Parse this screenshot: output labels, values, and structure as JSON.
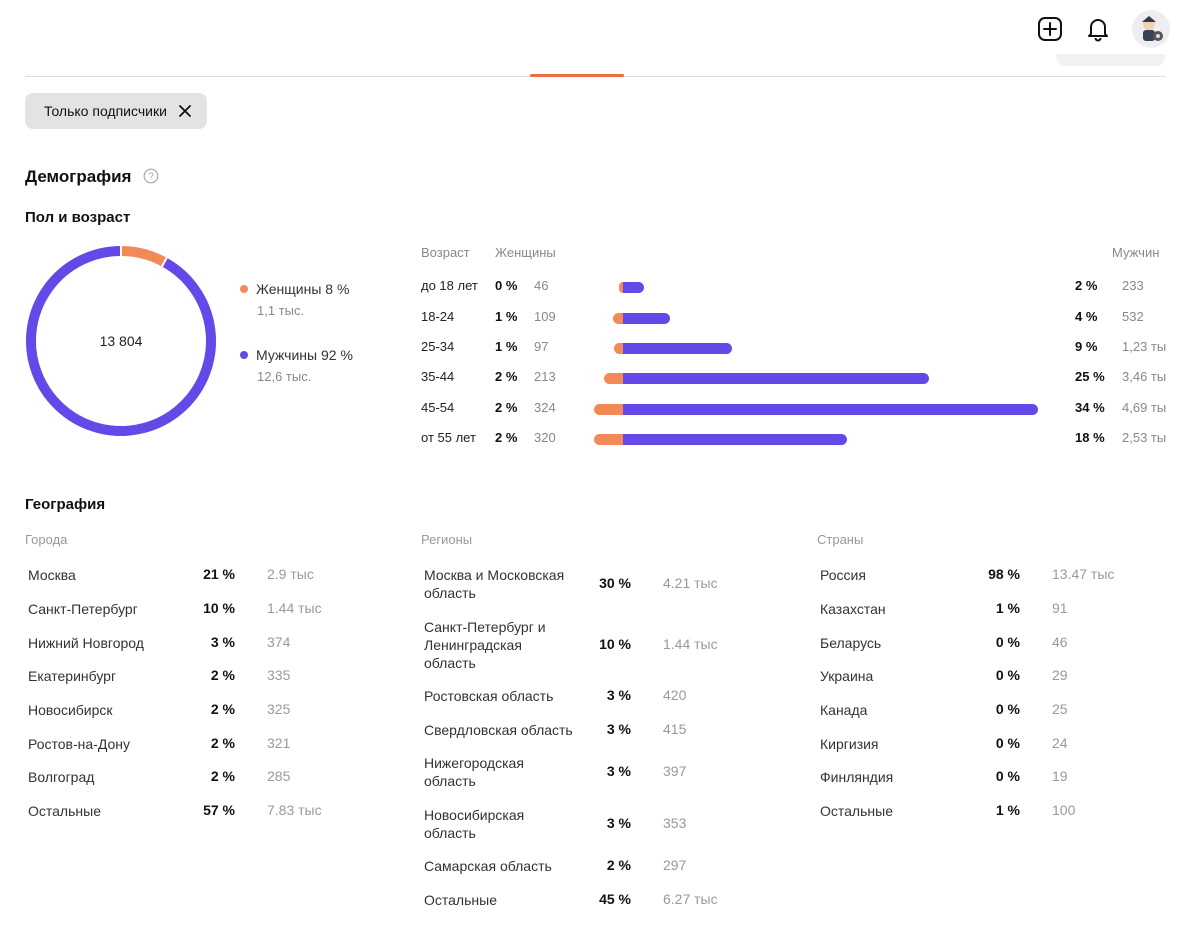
{
  "header": {
    "icons": [
      "add-post-icon",
      "bell-icon",
      "avatar"
    ]
  },
  "filter": {
    "chip_label": "Только подписчики"
  },
  "demography": {
    "title": "Демография",
    "gender_age_title": "Пол и возраст",
    "total": "13 804",
    "legend": [
      {
        "label": "Женщины 8 %",
        "sub": "1,1 тыс.",
        "color": "#f28a57"
      },
      {
        "label": "Мужчины 92 %",
        "sub": "12,6 тыс.",
        "color": "#6548e8"
      }
    ],
    "columns": {
      "age": "Возраст",
      "women": "Женщины",
      "men": "Мужчин"
    },
    "age_rows": [
      {
        "age": "до 18 лет",
        "w_pct": "0 %",
        "w_count": "46",
        "m_pct": "2 %",
        "m_count": "233"
      },
      {
        "age": "18-24",
        "w_pct": "1 %",
        "w_count": "109",
        "m_pct": "4 %",
        "m_count": "532"
      },
      {
        "age": "25-34",
        "w_pct": "1 %",
        "w_count": "97",
        "m_pct": "9 %",
        "m_count": "1,23 ты"
      },
      {
        "age": "35-44",
        "w_pct": "2 %",
        "w_count": "213",
        "m_pct": "25 %",
        "m_count": "3,46 ты"
      },
      {
        "age": "45-54",
        "w_pct": "2 %",
        "w_count": "324",
        "m_pct": "34 %",
        "m_count": "4,69 ты"
      },
      {
        "age": "от 55 лет",
        "w_pct": "2 %",
        "w_count": "320",
        "m_pct": "18 %",
        "m_count": "2,53 ты"
      }
    ]
  },
  "chart_data": [
    {
      "type": "pie",
      "categories": [
        "Женщины",
        "Мужчины"
      ],
      "values": [
        8,
        92
      ],
      "center_label": "13 804"
    },
    {
      "type": "bar",
      "categories": [
        "до 18 лет",
        "18-24",
        "25-34",
        "35-44",
        "45-54",
        "от 55 лет"
      ],
      "series": [
        {
          "name": "Женщины",
          "values": [
            46,
            109,
            97,
            213,
            324,
            320
          ]
        },
        {
          "name": "Мужчин",
          "values": [
            233,
            532,
            1230,
            3460,
            4690,
            2530
          ]
        }
      ]
    }
  ],
  "geography": {
    "title": "География",
    "cities": {
      "title": "Города",
      "rows": [
        {
          "name": "Москва",
          "pct": "21 %",
          "count": "2.9 тыс"
        },
        {
          "name": "Санкт-Петербург",
          "pct": "10 %",
          "count": "1.44 тыс"
        },
        {
          "name": "Нижний Новгород",
          "pct": "3 %",
          "count": "374"
        },
        {
          "name": "Екатеринбург",
          "pct": "2 %",
          "count": "335"
        },
        {
          "name": "Новосибирск",
          "pct": "2 %",
          "count": "325"
        },
        {
          "name": "Ростов-на-Дону",
          "pct": "2 %",
          "count": "321"
        },
        {
          "name": "Волгоград",
          "pct": "2 %",
          "count": "285"
        },
        {
          "name": "Остальные",
          "pct": "57 %",
          "count": "7.83 тыс"
        }
      ]
    },
    "regions": {
      "title": "Регионы",
      "rows": [
        {
          "name": "Москва и Московская область",
          "pct": "30 %",
          "count": "4.21 тыс"
        },
        {
          "name": "Санкт-Петербург и Ленинградская область",
          "pct": "10 %",
          "count": "1.44 тыс"
        },
        {
          "name": "Ростовская область",
          "pct": "3 %",
          "count": "420"
        },
        {
          "name": "Свердловская область",
          "pct": "3 %",
          "count": "415"
        },
        {
          "name": "Нижегородская область",
          "pct": "3 %",
          "count": "397"
        },
        {
          "name": "Новосибирская область",
          "pct": "3 %",
          "count": "353"
        },
        {
          "name": "Самарская область",
          "pct": "2 %",
          "count": "297"
        },
        {
          "name": "Остальные",
          "pct": "45 %",
          "count": "6.27 тыс"
        }
      ]
    },
    "countries": {
      "title": "Страны",
      "rows": [
        {
          "name": "Россия",
          "pct": "98 %",
          "count": "13.47 тыс"
        },
        {
          "name": "Казахстан",
          "pct": "1 %",
          "count": "91"
        },
        {
          "name": "Беларусь",
          "pct": "0 %",
          "count": "46"
        },
        {
          "name": "Украина",
          "pct": "0 %",
          "count": "29"
        },
        {
          "name": "Канада",
          "pct": "0 %",
          "count": "25"
        },
        {
          "name": "Киргизия",
          "pct": "0 %",
          "count": "24"
        },
        {
          "name": "Финляндия",
          "pct": "0 %",
          "count": "19"
        },
        {
          "name": "Остальные",
          "pct": "1 %",
          "count": "100"
        }
      ]
    }
  },
  "colors": {
    "accent": "#ef6c3e",
    "women": "#f28a57",
    "men": "#6548e8"
  }
}
